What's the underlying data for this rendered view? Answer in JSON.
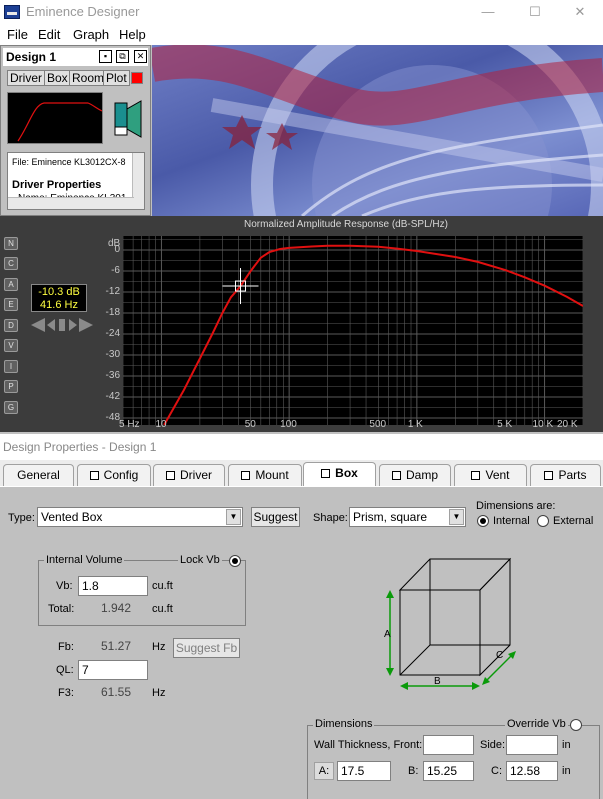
{
  "window": {
    "title": "Eminence Designer",
    "minimize": "—",
    "maximize": "☐",
    "close": "✕"
  },
  "menu": [
    "File",
    "Edit",
    "Graph",
    "Help"
  ],
  "design_window": {
    "title": "Design 1",
    "tabs": [
      "Driver",
      "Box",
      "Room",
      "Plot"
    ],
    "file_label": "File: Eminence KL3012CX-8",
    "driver_properties": "Driver Properties",
    "name_partial": "Name: Eminence KL301"
  },
  "graph": {
    "title": "Normalized Amplitude Response (dB-SPL/Hz)",
    "side_buttons": [
      "N",
      "C",
      "A",
      "E",
      "D",
      "V",
      "I",
      "P",
      "G"
    ],
    "readout_db": "-10.3 dB",
    "readout_hz": "41.6 Hz",
    "y_unit": "dB",
    "colors": {
      "curve": "#e01010",
      "grid": "#5a5a5a",
      "background": "#000000"
    }
  },
  "chart_data": {
    "type": "line",
    "title": "Normalized Amplitude Response (dB-SPL/Hz)",
    "xlabel": "Hz",
    "ylabel": "dB",
    "xscale": "log",
    "xlim": [
      5,
      20000
    ],
    "ylim": [
      -50,
      4
    ],
    "x_tick_labels": [
      "5 Hz",
      "10",
      "50",
      "100",
      "500",
      "1 K",
      "5 K",
      "10 K",
      "20 K"
    ],
    "x_tick_values": [
      5,
      10,
      50,
      100,
      500,
      1000,
      5000,
      10000,
      20000
    ],
    "y_ticks": [
      0,
      -6,
      -12,
      -18,
      -24,
      -30,
      -36,
      -42,
      -48
    ],
    "y_tick_labels": [
      "0",
      "-6",
      "-12",
      "-18",
      "-24",
      "-30",
      "-36",
      "-42",
      "-48"
    ],
    "grid": true,
    "series": [
      {
        "values": [
          [
            10.5,
            -50
          ],
          [
            15,
            -40
          ],
          [
            20,
            -31
          ],
          [
            25,
            -24
          ],
          [
            30,
            -18
          ],
          [
            35,
            -13.5
          ],
          [
            41.6,
            -10.3
          ],
          [
            50,
            -6
          ],
          [
            60,
            -2.2
          ],
          [
            70,
            -0.6
          ],
          [
            85,
            0.3
          ],
          [
            100,
            0.6
          ],
          [
            150,
            1.0
          ],
          [
            200,
            1.2
          ],
          [
            300,
            1.2
          ],
          [
            500,
            0.9
          ],
          [
            700,
            0.4
          ],
          [
            1000,
            -0.3
          ],
          [
            2000,
            -2.0
          ],
          [
            3000,
            -3.4
          ],
          [
            5000,
            -5.8
          ],
          [
            7000,
            -7.8
          ],
          [
            10000,
            -10.2
          ],
          [
            15000,
            -13.4
          ],
          [
            20000,
            -16.0
          ]
        ]
      }
    ],
    "cursor": {
      "x": 41.6,
      "y": -10.3
    }
  },
  "design_properties": {
    "title": "Design Properties - Design 1",
    "tabs": [
      "General",
      "Config",
      "Driver",
      "Mount",
      "Box",
      "Damp",
      "Vent",
      "Parts"
    ],
    "active_tab": "Box",
    "type_label": "Type:",
    "type_value": "Vented Box",
    "suggest_label": "Suggest",
    "shape_label": "Shape:",
    "shape_value": "Prism, square",
    "dimensions_are": "Dimensions are:",
    "internal_label": "Internal",
    "external_label": "External",
    "internal_volume_label": "Internal Volume",
    "lock_vb_label": "Lock Vb",
    "vb_label": "Vb:",
    "vb_value": "1.8",
    "vb_unit": "cu.ft",
    "total_label": "Total:",
    "total_value": "1.942",
    "total_unit": "cu.ft",
    "fb_label": "Fb:",
    "fb_value": "51.27",
    "fb_unit": "Hz",
    "suggest_fb_label": "Suggest Fb",
    "ql_label": "QL:",
    "ql_value": "7",
    "f3_label": "F3:",
    "f3_value": "61.55",
    "f3_unit": "Hz",
    "diagram_labels": {
      "a": "A",
      "b": "B",
      "c": "C"
    },
    "dimensions_group": "Dimensions",
    "override_vb_label": "Override Vb",
    "wall_thickness_label": "Wall Thickness, Front:",
    "wall_front_value": "",
    "side_label": "Side:",
    "side_value": "",
    "wall_unit": "in",
    "a_label": "A:",
    "a_value": "17.5",
    "b_label": "B:",
    "b_value": "15.25",
    "c_label": "C:",
    "c_value": "12.58",
    "dim_unit": "in"
  }
}
